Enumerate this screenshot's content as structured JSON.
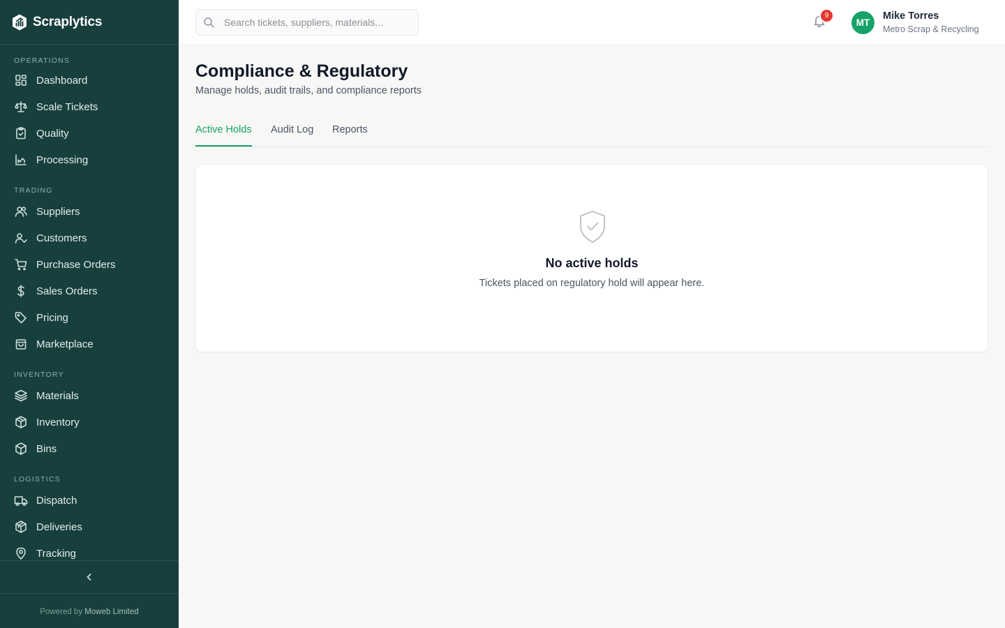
{
  "app": {
    "name": "Scraplytics"
  },
  "sidebar": {
    "sections": [
      {
        "title": "OPERATIONS",
        "items": [
          {
            "label": "Dashboard",
            "icon": "dashboard-icon"
          },
          {
            "label": "Scale Tickets",
            "icon": "scale-icon"
          },
          {
            "label": "Quality",
            "icon": "clipboard-check-icon"
          },
          {
            "label": "Processing",
            "icon": "factory-icon"
          }
        ]
      },
      {
        "title": "TRADING",
        "items": [
          {
            "label": "Suppliers",
            "icon": "users-icon"
          },
          {
            "label": "Customers",
            "icon": "user-check-icon"
          },
          {
            "label": "Purchase Orders",
            "icon": "cart-icon"
          },
          {
            "label": "Sales Orders",
            "icon": "dollar-icon"
          },
          {
            "label": "Pricing",
            "icon": "tag-icon"
          },
          {
            "label": "Marketplace",
            "icon": "shopping-bag-icon"
          }
        ]
      },
      {
        "title": "INVENTORY",
        "items": [
          {
            "label": "Materials",
            "icon": "layers-icon"
          },
          {
            "label": "Inventory",
            "icon": "package-icon"
          },
          {
            "label": "Bins",
            "icon": "box-icon"
          }
        ]
      },
      {
        "title": "LOGISTICS",
        "items": [
          {
            "label": "Dispatch",
            "icon": "truck-icon"
          },
          {
            "label": "Deliveries",
            "icon": "package-open-icon"
          },
          {
            "label": "Tracking",
            "icon": "map-pin-icon"
          }
        ]
      }
    ],
    "footer": {
      "prefix": "Powered by",
      "company": "Moweb Limited"
    }
  },
  "topbar": {
    "search_placeholder": "Search tickets, suppliers, materials...",
    "notification_count": "9",
    "user": {
      "initials": "MT",
      "name": "Mike Torres",
      "org": "Metro Scrap & Recycling"
    }
  },
  "main": {
    "title": "Compliance & Regulatory",
    "subtitle": "Manage holds, audit trails, and compliance reports",
    "tabs": [
      {
        "label": "Active Holds",
        "active": true
      },
      {
        "label": "Audit Log",
        "active": false
      },
      {
        "label": "Reports",
        "active": false
      }
    ],
    "empty_state": {
      "icon": "shield-check-icon",
      "title": "No active holds",
      "message": "Tickets placed on regulatory hold will appear here."
    }
  },
  "colors": {
    "sidebar_bg": "#173f3d",
    "accent": "#16a36a",
    "badge": "#e5392f"
  }
}
